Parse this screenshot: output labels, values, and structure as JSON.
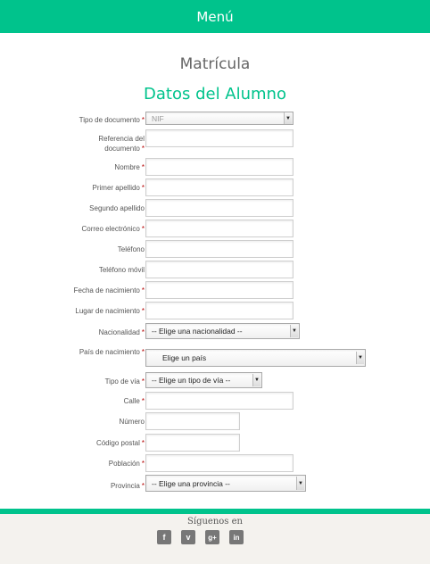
{
  "header": {
    "menu_label": "Menú"
  },
  "page": {
    "title": "Matrícula",
    "section_title": "Datos del Alumno"
  },
  "form": {
    "tipo_documento": {
      "label": "Tipo de documento",
      "value": "NIF"
    },
    "referencia": {
      "label_line1": "Referencia del",
      "label_line2": "documento"
    },
    "nombre": {
      "label": "Nombre"
    },
    "primer_apellido": {
      "label": "Primer apellido"
    },
    "segundo_apellido": {
      "label": "Segundo apellido"
    },
    "correo": {
      "label": "Correo electrónico"
    },
    "telefono": {
      "label": "Teléfono"
    },
    "telefono_movil": {
      "label": "Teléfono móvil"
    },
    "fecha_nacimiento": {
      "label": "Fecha de nacimiento"
    },
    "lugar_nacimiento": {
      "label": "Lugar de nacimiento"
    },
    "nacionalidad": {
      "label": "Nacionalidad",
      "value": "-- Elige una nacionalidad --"
    },
    "pais_nacimiento": {
      "label": "País de nacimiento",
      "value": "Elige un país"
    },
    "tipo_via": {
      "label": "Tipo de vía",
      "value": "-- Elige un tipo de vía --"
    },
    "calle": {
      "label": "Calle"
    },
    "numero": {
      "label": "Número"
    },
    "codigo_postal": {
      "label": "Código postal"
    },
    "poblacion": {
      "label": "Población"
    },
    "provincia": {
      "label": "Provincia",
      "value": "-- Elige una provincia --"
    },
    "required_mark": "*"
  },
  "footer": {
    "follow_label": "Síguenos en",
    "social": [
      "f",
      "v",
      "g+",
      "in"
    ]
  },
  "colors": {
    "accent": "#00c38c",
    "required": "#b40000"
  }
}
